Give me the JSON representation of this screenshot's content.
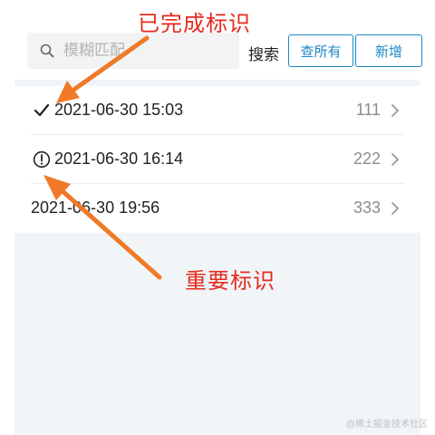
{
  "toolbar": {
    "search_placeholder": "模糊匹配",
    "search_value": "",
    "search_label": "搜索",
    "view_all_label": "查所有",
    "add_label": "新增"
  },
  "list": {
    "items": [
      {
        "date": "2021-06-30 15:03",
        "count": "111",
        "status": "completed",
        "icon": "check-icon"
      },
      {
        "date": "2021-06-30 16:14",
        "count": "222",
        "status": "important",
        "icon": "exclamation-circle-icon"
      },
      {
        "date": "2021-06-30 19:56",
        "count": "333",
        "status": "none",
        "icon": ""
      }
    ]
  },
  "annotations": {
    "completed_label": "已完成标识",
    "important_label": "重要标识"
  },
  "watermark": "@稀土掘金技术社区",
  "colors": {
    "accent": "#1e88c8",
    "annotation": "#e62b1e",
    "arrow": "#f07a28",
    "list_background": "#f1f5f8"
  }
}
